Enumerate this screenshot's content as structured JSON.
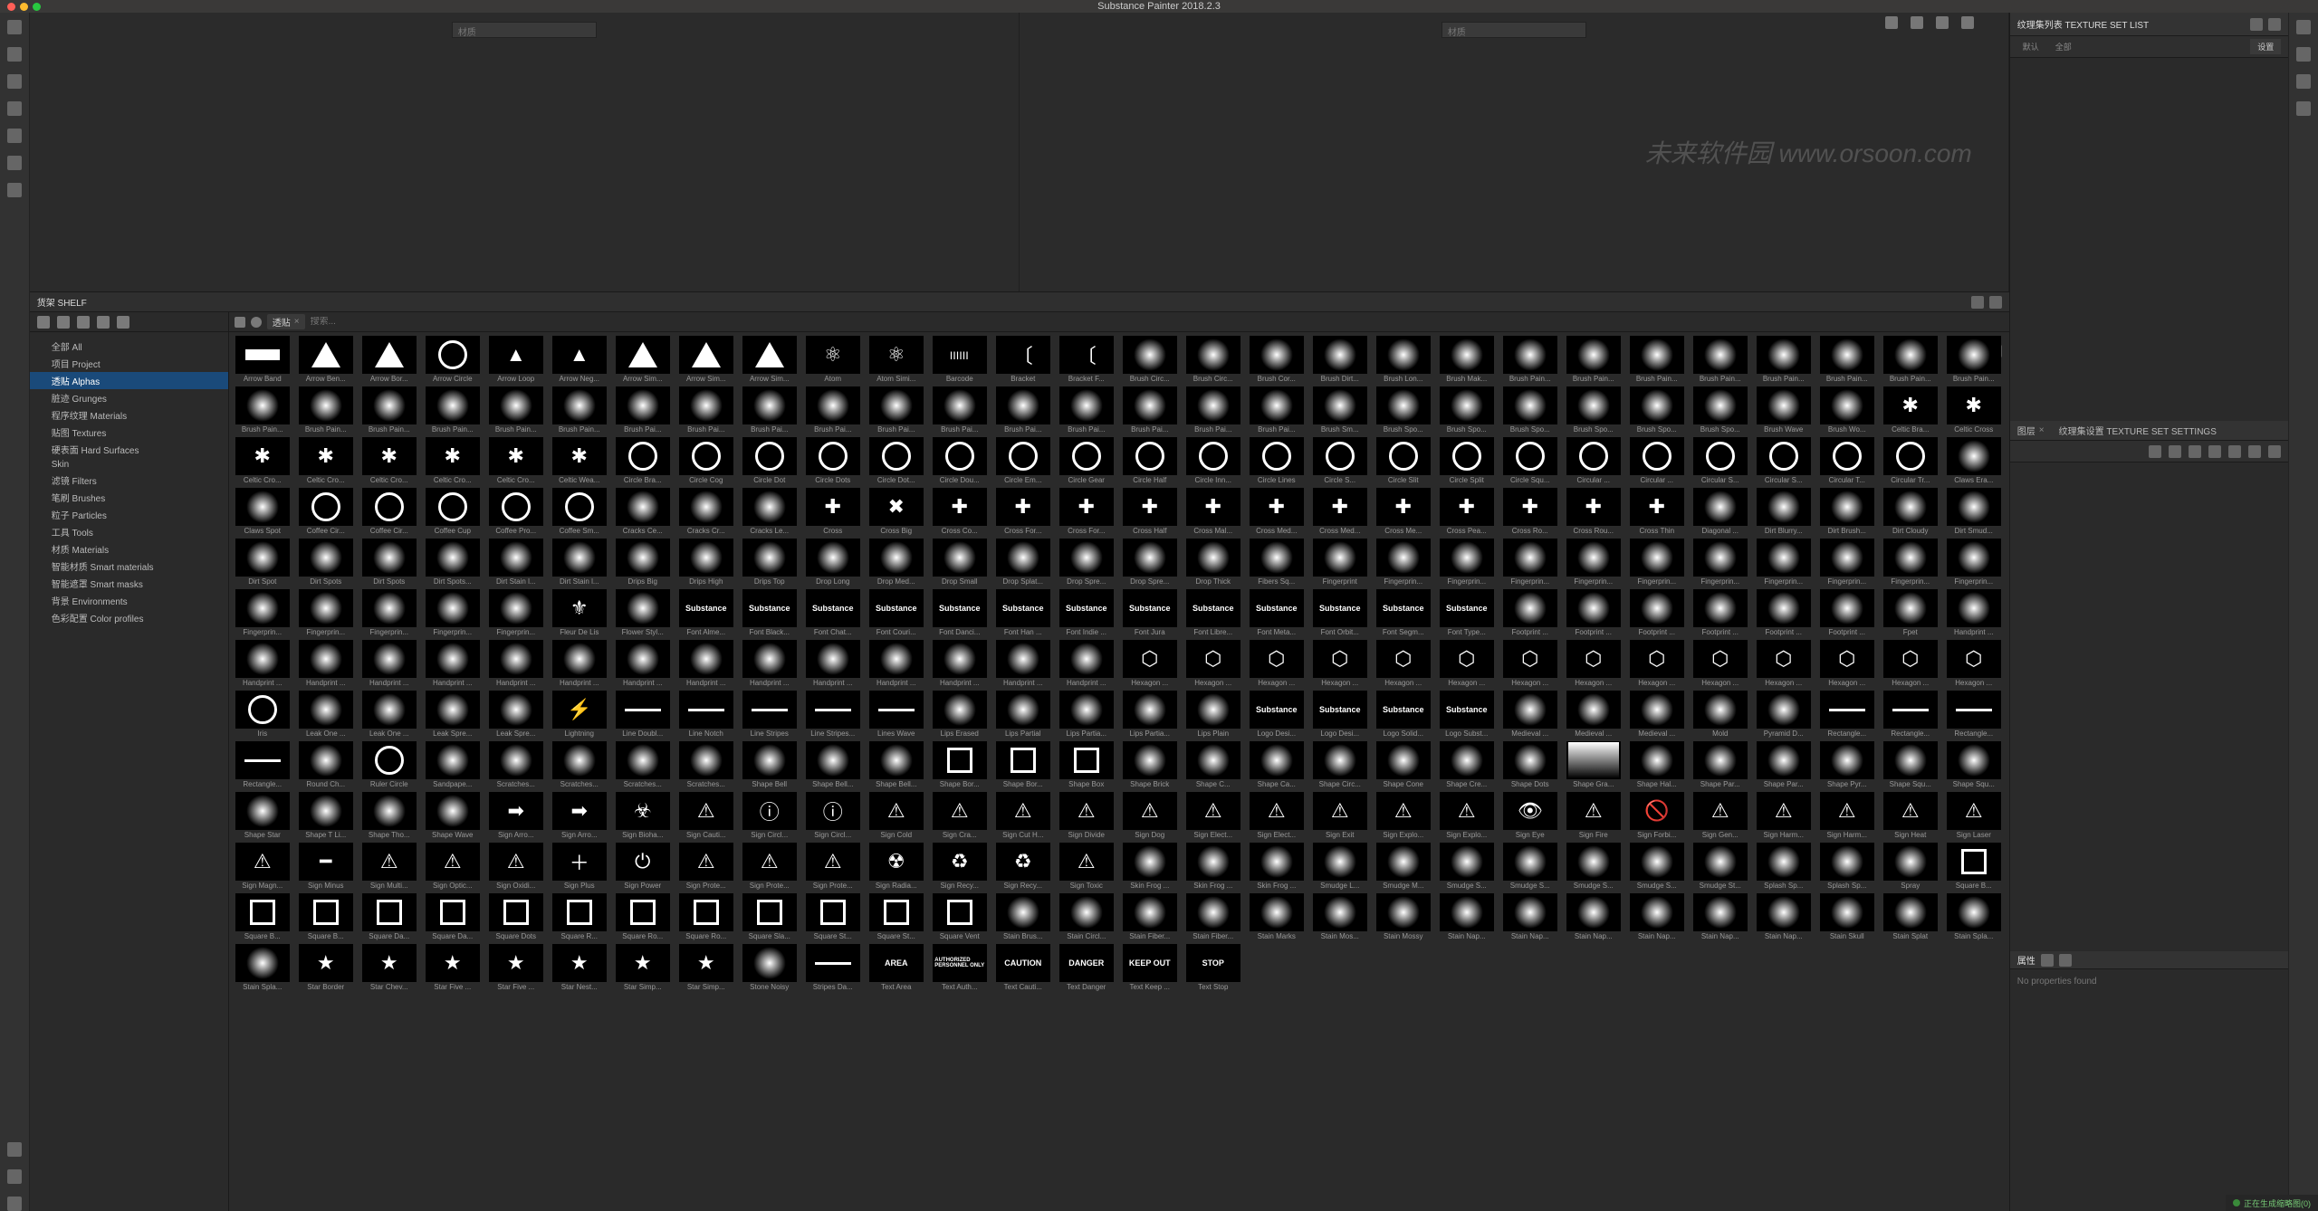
{
  "title": "Substance Painter 2018.2.3",
  "viewport": {
    "material_label": "材质"
  },
  "shelf": {
    "title": "货架 SHELF",
    "search_placeholder": "搜索...",
    "filter_pill": "透贴",
    "categories": [
      {
        "label": "全部 All"
      },
      {
        "label": "项目 Project"
      },
      {
        "label": "透贴 Alphas",
        "selected": true
      },
      {
        "label": "脏迹 Grunges"
      },
      {
        "label": "程序纹理 Materials"
      },
      {
        "label": "贴图 Textures"
      },
      {
        "label": "硬表面 Hard Surfaces"
      },
      {
        "label": "Skin"
      },
      {
        "label": "滤镜 Filters"
      },
      {
        "label": "笔刷 Brushes"
      },
      {
        "label": "粒子 Particles"
      },
      {
        "label": "工具 Tools"
      },
      {
        "label": "材质 Materials"
      },
      {
        "label": "智能材质 Smart materials"
      },
      {
        "label": "智能遮罩 Smart masks"
      },
      {
        "label": "背景 Environments"
      },
      {
        "label": "色彩配置 Color profiles"
      }
    ],
    "items": [
      "Arrow Band",
      "Arrow Ben...",
      "Arrow Bor...",
      "Arrow Circle",
      "Arrow Loop",
      "Arrow Neg...",
      "Arrow Sim...",
      "Arrow Sim...",
      "Arrow Sim...",
      "Atom",
      "Atom Simi...",
      "Barcode",
      "Bracket",
      "Bracket F...",
      "Brush Circ...",
      "Brush Circ...",
      "Brush Cor...",
      "Brush Dirt...",
      "Brush Lon...",
      "Brush Mak...",
      "Brush Pain...",
      "Brush Pain...",
      "Brush Pain...",
      "Brush Pain...",
      "Brush Pain...",
      "Brush Pain...",
      "Brush Pain...",
      "Brush Pain...",
      "Brush Pain...",
      "Brush Pain...",
      "Brush Pain...",
      "Brush Pain...",
      "Brush Pain...",
      "Brush Pain...",
      "Brush Pai...",
      "Brush Pai...",
      "Brush Pai...",
      "Brush Pai...",
      "Brush Pai...",
      "Brush Pai...",
      "Brush Pai...",
      "Brush Pai...",
      "Brush Pai...",
      "Brush Pai...",
      "Brush Pai...",
      "Brush Sm...",
      "Brush Spo...",
      "Brush Spo...",
      "Brush Spo...",
      "Brush Spo...",
      "Brush Spo...",
      "Brush Spo...",
      "Brush Wave",
      "Brush Wo...",
      "Celtic Bra...",
      "Celtic Cross",
      "Celtic Cro...",
      "Celtic Cro...",
      "Celtic Cro...",
      "Celtic Cro...",
      "Celtic Cro...",
      "Celtic Wea...",
      "Circle Bra...",
      "Circle Cog",
      "Circle Dot",
      "Circle Dots",
      "Circle Dot...",
      "Circle Dou...",
      "Circle Em...",
      "Circle Gear",
      "Circle Half",
      "Circle Inn...",
      "Circle Lines",
      "Circle S...",
      "Circle Slit",
      "Circle Split",
      "Circle Squ...",
      "Circular ...",
      "Circular ...",
      "Circular S...",
      "Circular S...",
      "Circular T...",
      "Circular Tr...",
      "Claws Era...",
      "Claws Spot",
      "Coffee Cir...",
      "Coffee Cir...",
      "Coffee Cup",
      "Coffee Pro...",
      "Coffee Sm...",
      "Cracks Ce...",
      "Cracks Cr...",
      "Cracks Le...",
      "Cross",
      "Cross Big",
      "Cross Co...",
      "Cross For...",
      "Cross For...",
      "Cross Half",
      "Cross Mal...",
      "Cross Med...",
      "Cross Med...",
      "Cross Me...",
      "Cross Pea...",
      "Cross Ro...",
      "Cross Rou...",
      "Cross Thin",
      "Diagonal ...",
      "Dirt Blurry...",
      "Dirt Brush...",
      "Dirt Cloudy",
      "Dirt Smud...",
      "Dirt Spot",
      "Dirt Spots",
      "Dirt Spots",
      "Dirt Spots...",
      "Dirt Stain l...",
      "Dirt Stain l...",
      "Drips Big",
      "Drips High",
      "Drips Top",
      "Drop Long",
      "Drop Med...",
      "Drop Small",
      "Drop Splat...",
      "Drop Spre...",
      "Drop Spre...",
      "Drop Thick",
      "Fibers Sq...",
      "Fingerprint",
      "Fingerprin...",
      "Fingerprin...",
      "Fingerprin...",
      "Fingerprin...",
      "Fingerprin...",
      "Fingerprin...",
      "Fingerprin...",
      "Fingerprin...",
      "Fingerprin...",
      "Fingerprin...",
      "Fingerprin...",
      "Fingerprin...",
      "Fingerprin...",
      "Fingerprin...",
      "Fingerprin...",
      "Fleur De Lis",
      "Flower Styl...",
      "Font Alme...",
      "Font Black...",
      "Font Chat...",
      "Font Couri...",
      "Font Danci...",
      "Font Han ...",
      "Font Indie ...",
      "Font Jura",
      "Font Libre...",
      "Font Meta...",
      "Font Orbit...",
      "Font Segm...",
      "Font Type...",
      "Footprint ...",
      "Footprint ...",
      "Footprint ...",
      "Footprint ...",
      "Footprint ...",
      "Footprint ...",
      "Fpet",
      "Handprint ...",
      "Handprint ...",
      "Handprint ...",
      "Handprint ...",
      "Handprint ...",
      "Handprint ...",
      "Handprint ...",
      "Handprint ...",
      "Handprint ...",
      "Handprint ...",
      "Handprint ...",
      "Handprint ...",
      "Handprint ...",
      "Handprint ...",
      "Handprint ...",
      "Hexagon ...",
      "Hexagon ...",
      "Hexagon ...",
      "Hexagon ...",
      "Hexagon ...",
      "Hexagon ...",
      "Hexagon ...",
      "Hexagon ...",
      "Hexagon ...",
      "Hexagon ...",
      "Hexagon ...",
      "Hexagon ...",
      "Hexagon ...",
      "Hexagon ...",
      "Iris",
      "Leak One ...",
      "Leak One ...",
      "Leak Spre...",
      "Leak Spre...",
      "Lightning",
      "Line Doubl...",
      "Line Notch",
      "Line Stripes",
      "Line Stripes...",
      "Lines Wave",
      "Lips Erased",
      "Lips Partial",
      "Lips Partia...",
      "Lips Partia...",
      "Lips Plain",
      "Logo Desi...",
      "Logo Desi...",
      "Logo Solid...",
      "Logo Subst...",
      "Medieval ...",
      "Medieval ...",
      "Medieval ...",
      "Mold",
      "Pyramid D...",
      "Rectangle...",
      "Rectangle...",
      "Rectangle...",
      "Rectangle...",
      "Round Ch...",
      "Ruler Circle",
      "Sandpape...",
      "Scratches...",
      "Scratches...",
      "Scratches...",
      "Scratches...",
      "Shape Bell",
      "Shape Bell...",
      "Shape Bell...",
      "Shape Bor...",
      "Shape Bor...",
      "Shape Box",
      "Shape Brick",
      "Shape C...",
      "Shape Ca...",
      "Shape Circ...",
      "Shape Cone",
      "Shape Cre...",
      "Shape Dots",
      "Shape Gra...",
      "Shape Hal...",
      "Shape Par...",
      "Shape Par...",
      "Shape Pyr...",
      "Shape Squ...",
      "Shape Squ...",
      "Shape Star",
      "Shape T Li...",
      "Shape Tho...",
      "Shape Wave",
      "Sign Arro...",
      "Sign Arro...",
      "Sign Bioha...",
      "Sign Cauti...",
      "Sign Circl...",
      "Sign Circl...",
      "Sign Cold",
      "Sign Cra...",
      "Sign Cut H...",
      "Sign Divide",
      "Sign Dog",
      "Sign Elect...",
      "Sign Elect...",
      "Sign Exit",
      "Sign Explo...",
      "Sign Explo...",
      "Sign Eye",
      "Sign Fire",
      "Sign Forbi...",
      "Sign Gen...",
      "Sign Harm...",
      "Sign Harm...",
      "Sign Heat",
      "Sign Laser",
      "Sign Magn...",
      "Sign Minus",
      "Sign Multi...",
      "Sign Optic...",
      "Sign Oxidi...",
      "Sign Plus",
      "Sign Power",
      "Sign Prote...",
      "Sign Prote...",
      "Sign Prote...",
      "Sign Radia...",
      "Sign Recy...",
      "Sign Recy...",
      "Sign Toxic",
      "Skin Frog ...",
      "Skin Frog ...",
      "Skin Frog ...",
      "Smudge L...",
      "Smudge M...",
      "Smudge S...",
      "Smudge S...",
      "Smudge S...",
      "Smudge S...",
      "Smudge St...",
      "Splash Sp...",
      "Splash Sp...",
      "Spray",
      "Square B...",
      "Square B...",
      "Square B...",
      "Square Da...",
      "Square Da...",
      "Square Dots",
      "Square R...",
      "Square Ro...",
      "Square Ro...",
      "Square Sla...",
      "Square St...",
      "Square St...",
      "Square Vent",
      "Stain Brus...",
      "Stain Circl...",
      "Stain Fiber...",
      "Stain Fiber...",
      "Stain Marks",
      "Stain Mos...",
      "Stain Mossy",
      "Stain Nap...",
      "Stain Nap...",
      "Stain Nap...",
      "Stain Nap...",
      "Stain Nap...",
      "Stain Nap...",
      "Stain Skull",
      "Stain Splat",
      "Stain Spla...",
      "Stain Spla...",
      "Star Border",
      "Star Chev...",
      "Star Five ...",
      "Star Five ...",
      "Star Nest...",
      "Star Simp...",
      "Star Simp...",
      "Stone Noisy",
      "Stripes Da...",
      "Text Area",
      "Text Auth...",
      "Text Cauti...",
      "Text Danger",
      "Text Keep ...",
      "Text Stop"
    ]
  },
  "right": {
    "texture_set_list": {
      "title": "纹理集列表 TEXTURE SET LIST",
      "btn1": "默认",
      "btn2": "全部",
      "settings": "设置"
    },
    "tss": {
      "tab1": "图层",
      "tab2": "纹理集设置 TEXTURE SET SETTINGS"
    },
    "properties": {
      "title": "属性",
      "empty": "No properties found"
    }
  },
  "status": "正在生成缩略图(0)",
  "watermark": "未来软件园\nwww.orsoon.com"
}
